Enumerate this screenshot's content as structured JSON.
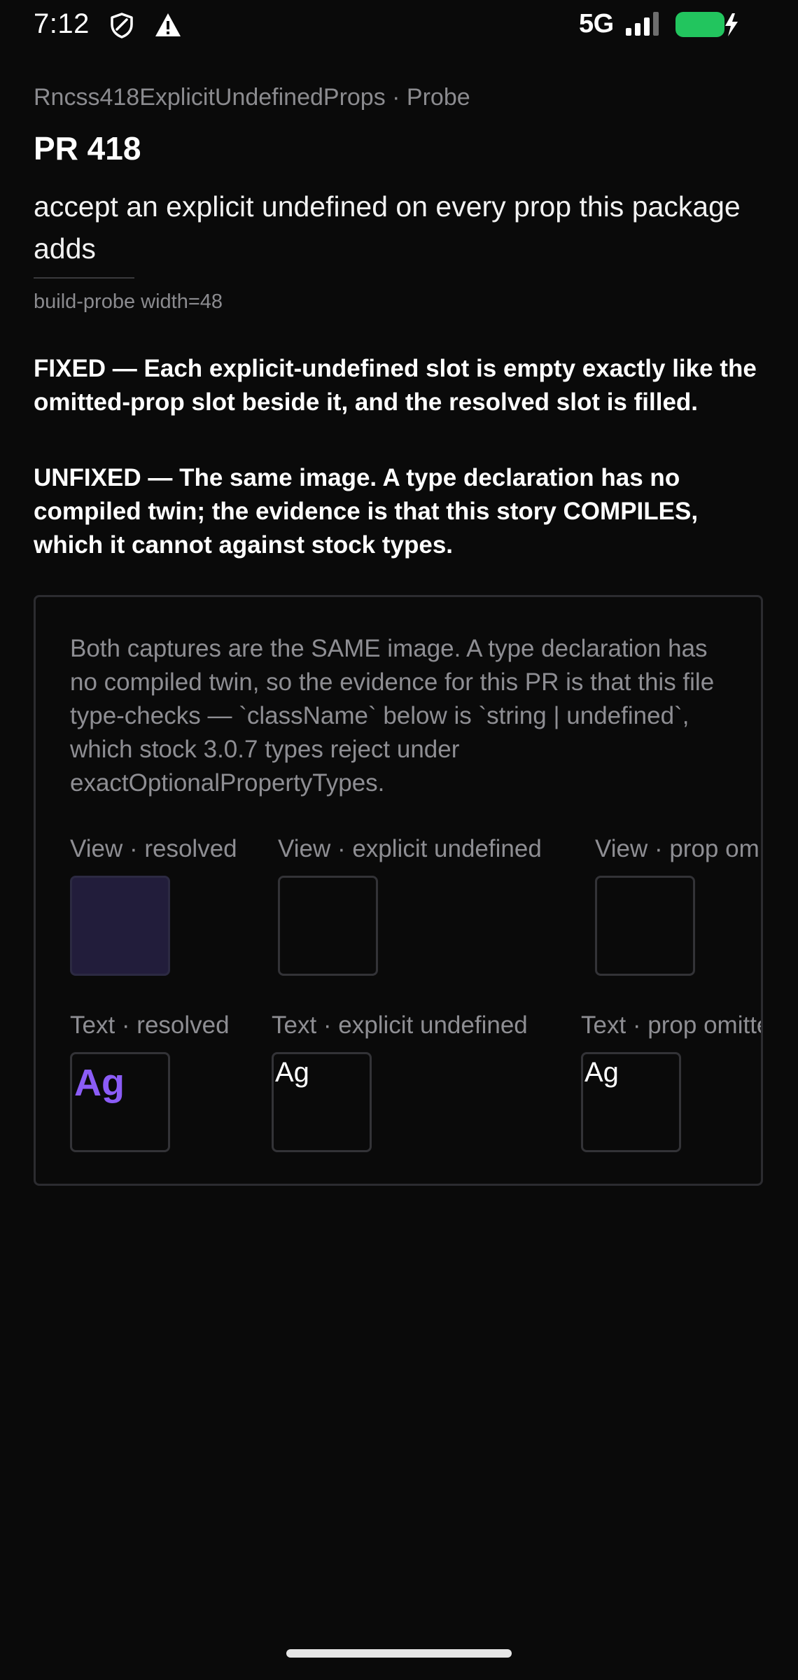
{
  "status_bar": {
    "time": "7:12",
    "network": "5G",
    "icons": [
      "shield-icon",
      "alert-icon",
      "signal-icon",
      "battery-charging-icon"
    ],
    "battery_color": "#22c55e"
  },
  "header": {
    "breadcrumb": "Rncss418ExplicitUndefinedProps · Probe",
    "title": "PR 418",
    "description": "accept an explicit undefined on every prop this package adds",
    "probe_meta": "build-probe width=48"
  },
  "results": {
    "fixed": "FIXED — Each explicit-undefined slot is empty exactly like the omitted-prop slot beside it, and the resolved slot is filled.",
    "unfixed": "UNFIXED — The same image. A type declaration has no compiled twin; the evidence is that this story COMPILES, which it cannot against stock types."
  },
  "probe": {
    "note": "Both captures are the SAME image. A type declaration has no compiled twin, so the evidence for this PR is that this file type-checks — `className` below is `string | undefined`, which stock 3.0.7 types reject under exactOptionalPropertyTypes.",
    "view_row": [
      {
        "label": "View · resolved",
        "state": "filled"
      },
      {
        "label": "View · explicit undefined",
        "state": "empty"
      },
      {
        "label": "View · prop omitted",
        "state": "empty"
      }
    ],
    "text_row": [
      {
        "label": "Text · resolved",
        "sample": "Ag",
        "state": "styled"
      },
      {
        "label": "Text · explicit undefined",
        "sample": "Ag",
        "state": "plain"
      },
      {
        "label": "Text · prop omitted",
        "sample": "Ag",
        "state": "plain"
      }
    ],
    "colors": {
      "resolved_fill": "#221d3b",
      "resolved_text": "#8b5cf6"
    }
  }
}
